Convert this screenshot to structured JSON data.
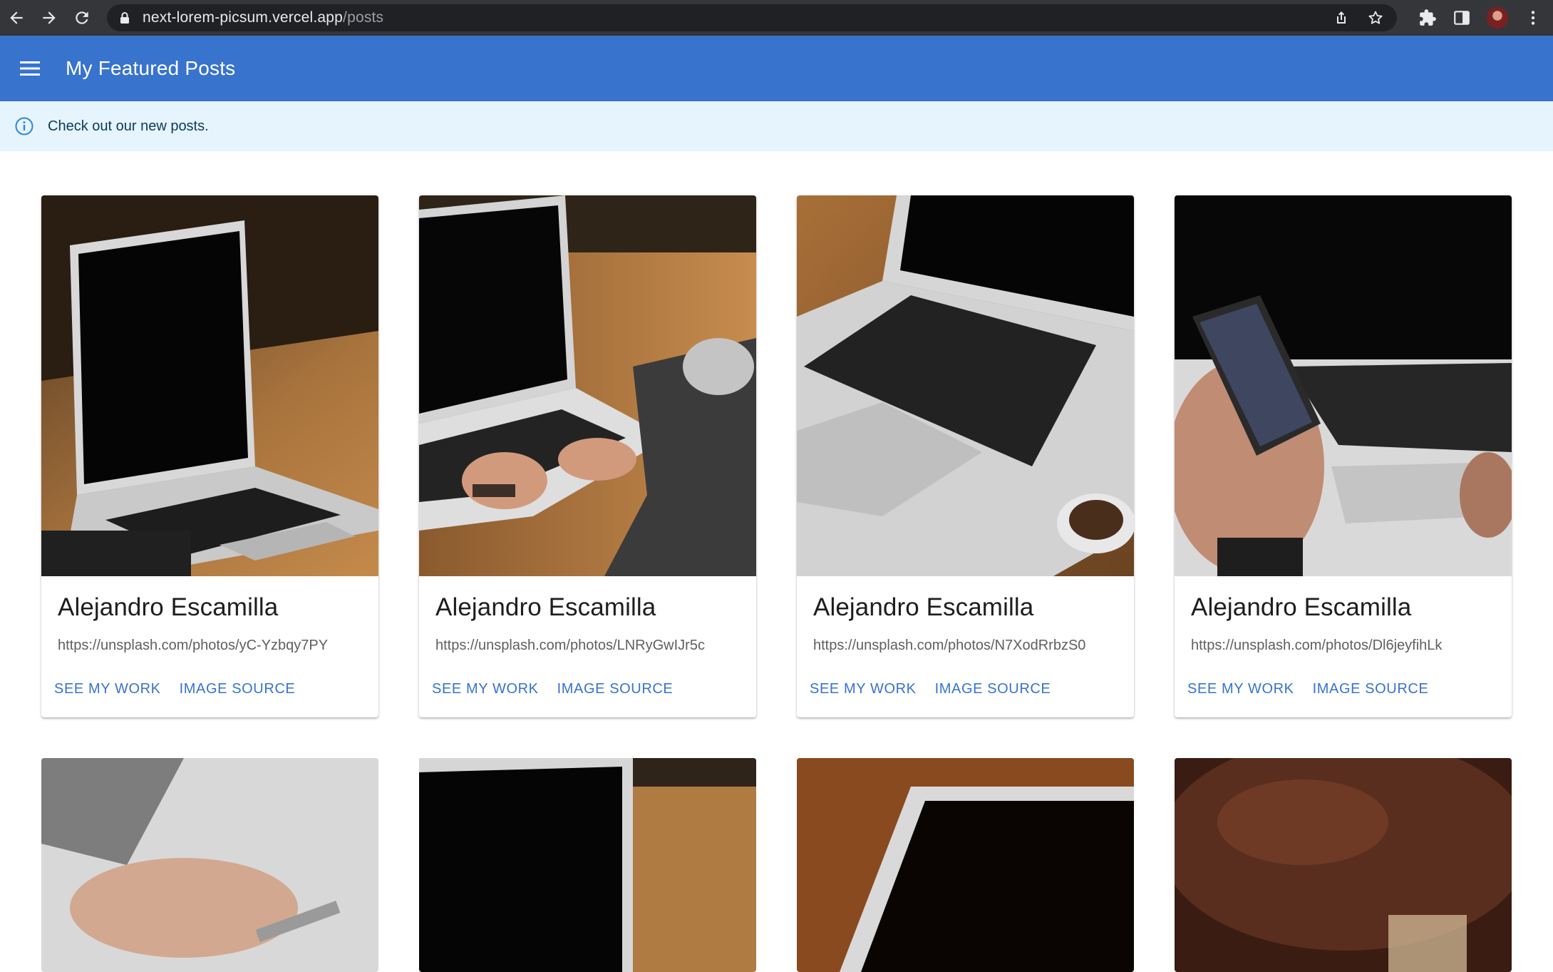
{
  "browser": {
    "url_host": "next-lorem-picsum.vercel.app",
    "url_path": "/posts"
  },
  "appbar": {
    "title": "My Featured Posts"
  },
  "alert": {
    "text": "Check out our new posts."
  },
  "posts": [
    {
      "author": "Alejandro Escamilla",
      "url": "https://unsplash.com/photos/yC-Yzbqy7PY",
      "see_work": "SEE MY WORK",
      "image_source": "IMAGE SOURCE"
    },
    {
      "author": "Alejandro Escamilla",
      "url": "https://unsplash.com/photos/LNRyGwIJr5c",
      "see_work": "SEE MY WORK",
      "image_source": "IMAGE SOURCE"
    },
    {
      "author": "Alejandro Escamilla",
      "url": "https://unsplash.com/photos/N7XodRrbzS0",
      "see_work": "SEE MY WORK",
      "image_source": "IMAGE SOURCE"
    },
    {
      "author": "Alejandro Escamilla",
      "url": "https://unsplash.com/photos/Dl6jeyfihLk",
      "see_work": "SEE MY WORK",
      "image_source": "IMAGE SOURCE"
    }
  ],
  "colors": {
    "primary": "#3873cd",
    "chrome_bg": "#35363a",
    "alert_bg": "#e5f4fd"
  }
}
